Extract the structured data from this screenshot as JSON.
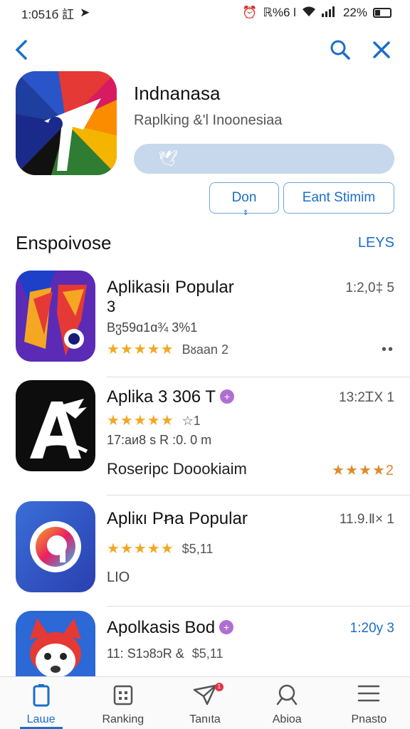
{
  "status": {
    "time": "1:051б 訌",
    "signal_text": "ℝ%6 l",
    "battery": "22%"
  },
  "nav": {
    "back_icon": "chevron-left-icon",
    "search_icon": "search-icon",
    "close_icon": "close-icon"
  },
  "header": {
    "title": "Indnanasa",
    "subtitle": "Raplking &'l Inoonesiaa",
    "progress_percent": 100,
    "button_small": "Don",
    "button_wide": "Eant Stimim"
  },
  "section": {
    "title": "Enspoivose",
    "link": "LEYS"
  },
  "apps": [
    {
      "name": "Aplikasiı Popular",
      "name2": "3",
      "time": "1:2,0‡ 5",
      "info": "Bჳ59ɑ1ɑ¾ 3%1",
      "rating": 5,
      "meta": "Bᴕaan 2",
      "more": "••"
    },
    {
      "name": "Aplika 3 306 T",
      "time": "13:2ᏆX 1",
      "rating": 5,
      "rating_meta": "☆1",
      "info": "17:aᴎ8 s R :0. 0 m",
      "desc": "Roseripc Doookiaim",
      "right_rating": "★★★★2"
    },
    {
      "name": "Apliкı Pꞥa Popular",
      "time": "11.9.Ⅱ× 1",
      "rating": 5,
      "meta": "$5,11",
      "info": "LIO"
    },
    {
      "name": "Apolkasis Bod",
      "time": "1:20у 3",
      "info": "11: S1ᴐ8ᴐR &",
      "meta": "$5,11"
    }
  ],
  "tabs": [
    {
      "label": "Laɯe",
      "icon": "phone-icon",
      "active": true
    },
    {
      "label": "Ranking",
      "icon": "calendar-icon",
      "active": false
    },
    {
      "label": "Tanıta",
      "icon": "paper-plane-icon",
      "active": false,
      "badge": "1"
    },
    {
      "label": "Abioa",
      "icon": "search-icon",
      "active": false
    },
    {
      "label": "Pnasto",
      "icon": "menu-icon",
      "active": false
    }
  ],
  "colors": {
    "accent": "#1a6fc9",
    "star": "#f2a825"
  }
}
